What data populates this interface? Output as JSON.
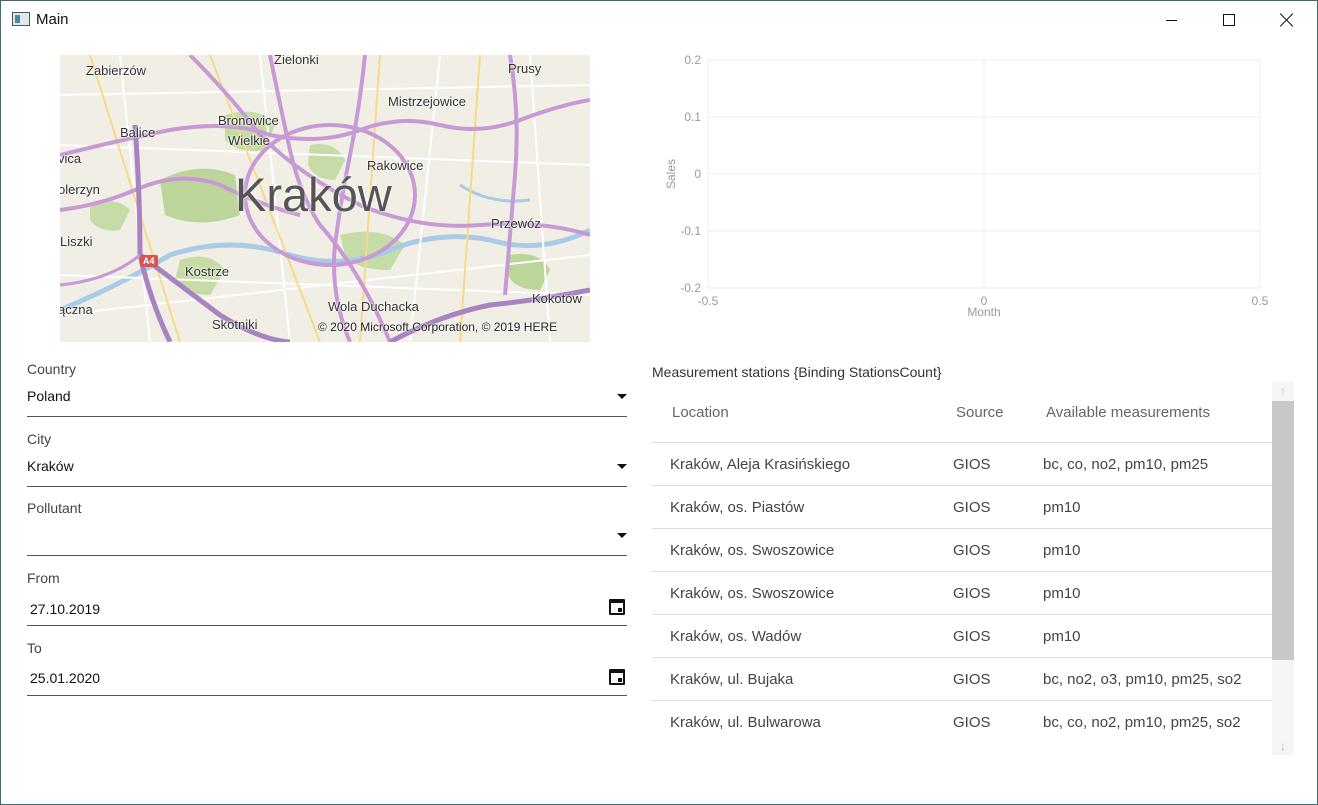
{
  "window": {
    "title": "Main",
    "app_icon": "app-window-icon"
  },
  "map": {
    "city_label": "Kraków",
    "copyright": "© 2020 Microsoft Corporation, © 2019 HERE",
    "road_shield": "A4",
    "places": [
      "Zabierzów",
      "Zielonki",
      "Prusy",
      "Mistrzejowice",
      "Balice",
      "Bronowice",
      "Wielkie",
      "Rakowice",
      "vica",
      "olerzyn",
      "Liszki",
      "Przewóz",
      "Kostrze",
      "Kokotów",
      "ączna",
      "Wola Duchacka",
      "Skotniki"
    ]
  },
  "chart_data": {
    "type": "line",
    "title": "",
    "xlabel": "Month",
    "ylabel": "Sales",
    "xlim": [
      -0.5,
      0.5
    ],
    "ylim": [
      -0.2,
      0.2
    ],
    "x_ticks": [
      "-0.5",
      "0",
      "0.5"
    ],
    "y_ticks": [
      "0.2",
      "0.1",
      "0",
      "-0.1",
      "-0.2"
    ],
    "series": [],
    "grid": true
  },
  "form": {
    "country": {
      "label": "Country",
      "value": "Poland"
    },
    "city": {
      "label": "City",
      "value": "Kraków"
    },
    "pollutant": {
      "label": "Pollutant",
      "value": ""
    },
    "from": {
      "label": "From",
      "value": "27.10.2019"
    },
    "to": {
      "label": "To",
      "value": "25.01.2020"
    }
  },
  "stations": {
    "title": "Measurement stations {Binding StationsCount}",
    "columns": [
      "Location",
      "Source",
      "Available measurements"
    ],
    "rows": [
      {
        "location": "Kraków, Aleja Krasińskiego",
        "source": "GIOS",
        "measurements": "bc, co, no2, pm10, pm25"
      },
      {
        "location": "Kraków, os. Piastów",
        "source": "GIOS",
        "measurements": "pm10"
      },
      {
        "location": "Kraków, os. Swoszowice",
        "source": "GIOS",
        "measurements": "pm10"
      },
      {
        "location": "Kraków, os. Swoszowice",
        "source": "GIOS",
        "measurements": "pm10"
      },
      {
        "location": "Kraków, os. Wadów",
        "source": "GIOS",
        "measurements": "pm10"
      },
      {
        "location": "Kraków, ul. Bujaka",
        "source": "GIOS",
        "measurements": "bc, no2, o3, pm10, pm25, so2"
      },
      {
        "location": "Kraków, ul. Bulwarowa",
        "source": "GIOS",
        "measurements": "bc, co, no2, pm10, pm25, so2"
      }
    ]
  }
}
